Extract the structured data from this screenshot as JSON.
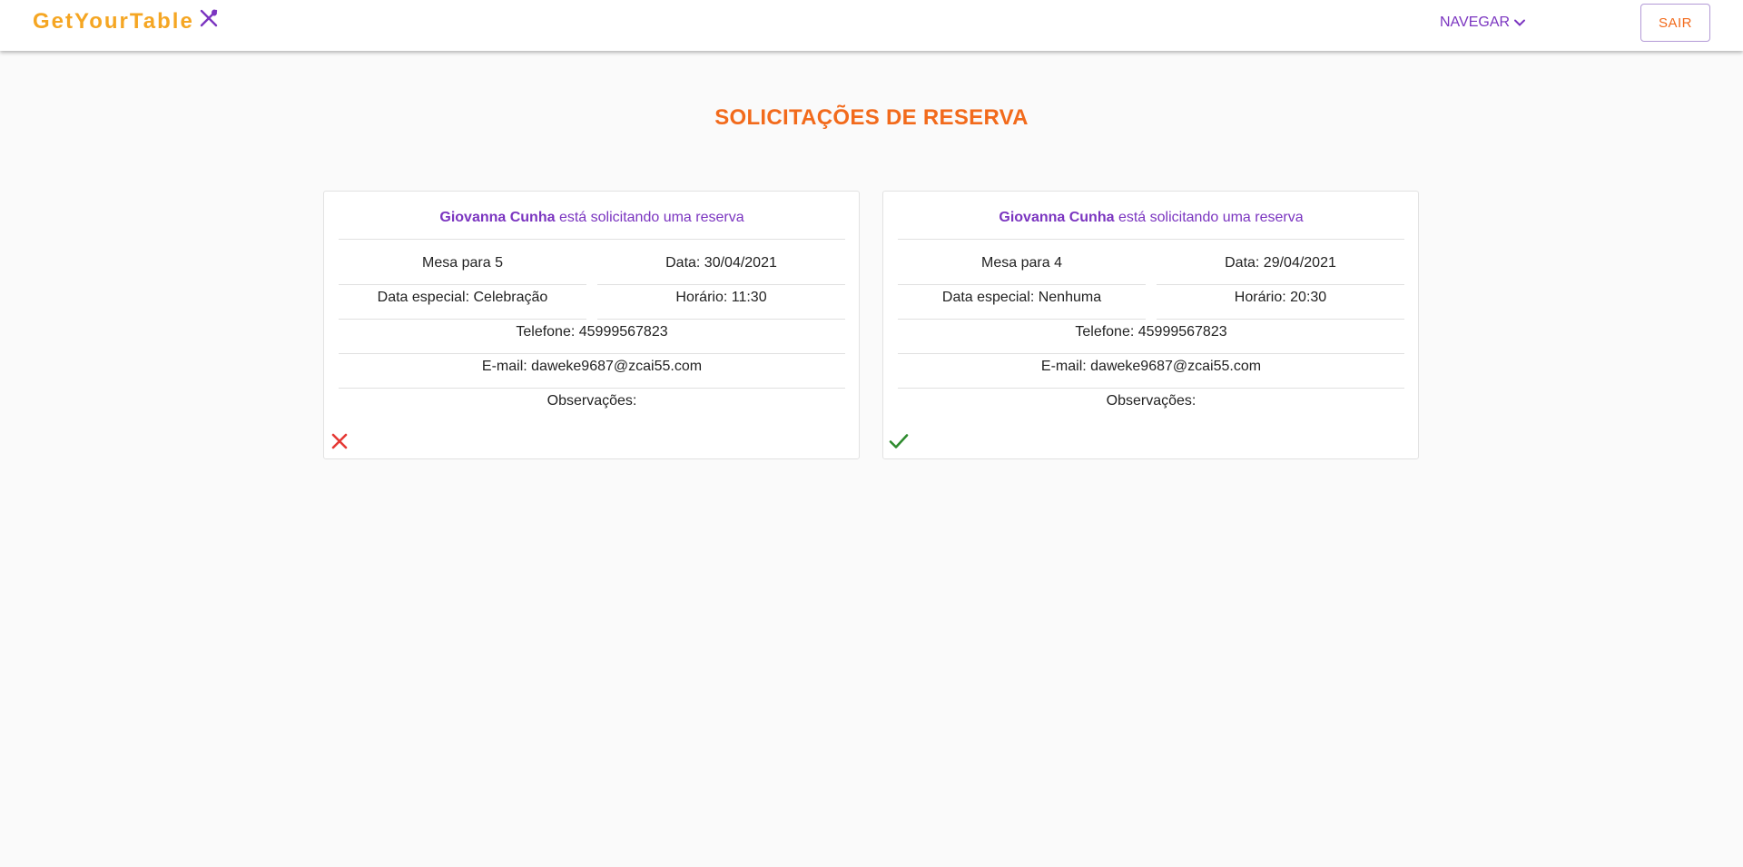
{
  "header": {
    "brand": "GetYourTable",
    "brand_icon": "utensils-icon",
    "nav_label": "NAVEGAR",
    "logout_label": "SAIR"
  },
  "colors": {
    "brand": "#f5a623",
    "accent_purple": "#7b35c0",
    "accent_orange": "#f26a1b",
    "reject_red": "#e53935",
    "accept_green": "#2e8b2e"
  },
  "page": {
    "title": "SOLICITAÇÕES DE RESERVA"
  },
  "requests": [
    {
      "name": "Giovanna Cunha",
      "request_text": "está solicitando uma reserva",
      "table": "Mesa para 5",
      "date": "Data: 30/04/2021",
      "special_date": "Data especial: Celebração",
      "time": "Horário: 11:30",
      "phone": "Telefone: 45999567823",
      "email": "E-mail: daweke9687@zcai55.com",
      "notes": "Observações:",
      "status_icon": "close-icon"
    },
    {
      "name": "Giovanna Cunha",
      "request_text": "está solicitando uma reserva",
      "table": "Mesa para 4",
      "date": "Data: 29/04/2021",
      "special_date": "Data especial: Nenhuma",
      "time": "Horário: 20:30",
      "phone": "Telefone: 45999567823",
      "email": "E-mail: daweke9687@zcai55.com",
      "notes": "Observações:",
      "status_icon": "check-icon"
    }
  ]
}
